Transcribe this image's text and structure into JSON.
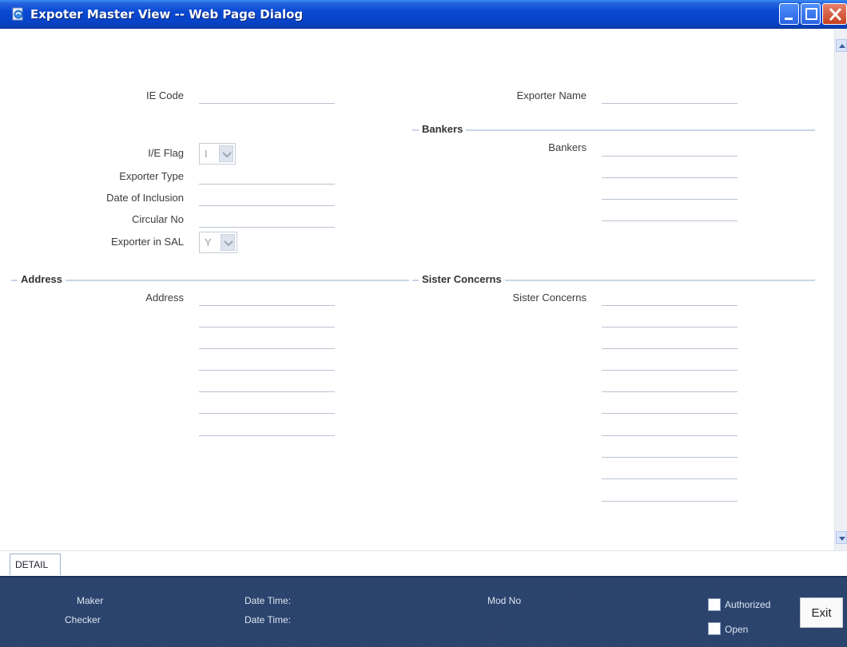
{
  "window": {
    "title": "Expoter Master View -- Web Page Dialog"
  },
  "form": {
    "ie_code_label": "IE Code",
    "exporter_name_label": "Exporter Name",
    "ie_flag_label": "I/E Flag",
    "ie_flag_value": "I",
    "exporter_type_label": "Exporter Type",
    "date_of_inclusion_label": "Date of Inclusion",
    "circular_no_label": "Circular No",
    "exporter_in_sal_label": "Exporter in SAL",
    "exporter_in_sal_value": "Y"
  },
  "sections": {
    "bankers_title": "Bankers",
    "bankers_label": "Bankers",
    "address_title": "Address",
    "address_label": "Address",
    "sister_title": "Sister Concerns",
    "sister_label": "Sister Concerns"
  },
  "tabs": {
    "detail": "DETAIL"
  },
  "footer": {
    "maker": "Maker",
    "checker": "Checker",
    "date_time_1": "Date Time:",
    "date_time_2": "Date Time:",
    "mod_no": "Mod No",
    "authorized": "Authorized",
    "open": "Open",
    "exit": "Exit"
  },
  "colors": {
    "title_bar": "#0a49d4",
    "footer_bg": "#2d4672",
    "section_rule": "#c8d4e8"
  }
}
